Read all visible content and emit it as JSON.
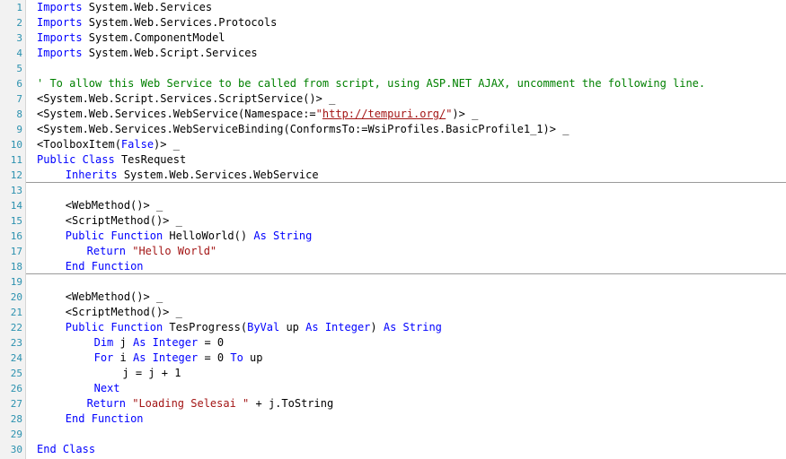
{
  "editor": {
    "lines": [
      {
        "n": "1",
        "indent": 0,
        "tokens": [
          {
            "t": "Imports",
            "k": "kw"
          },
          {
            "t": " System.Web.Services",
            "k": "tx"
          }
        ]
      },
      {
        "n": "2",
        "indent": 0,
        "tokens": [
          {
            "t": "Imports",
            "k": "kw"
          },
          {
            "t": " System.Web.Services.Protocols",
            "k": "tx"
          }
        ]
      },
      {
        "n": "3",
        "indent": 0,
        "tokens": [
          {
            "t": "Imports",
            "k": "kw"
          },
          {
            "t": " System.ComponentModel",
            "k": "tx"
          }
        ]
      },
      {
        "n": "4",
        "indent": 0,
        "tokens": [
          {
            "t": "Imports",
            "k": "kw"
          },
          {
            "t": " System.Web.Script.Services",
            "k": "tx"
          }
        ]
      },
      {
        "n": "5",
        "indent": 0,
        "tokens": []
      },
      {
        "n": "6",
        "indent": 0,
        "tokens": [
          {
            "t": "' To allow this Web Service to be called from script, using ASP.NET AJAX, uncomment the following line.",
            "k": "cm"
          }
        ]
      },
      {
        "n": "7",
        "indent": 0,
        "tokens": [
          {
            "t": "<System.Web.Script.Services.ScriptService()> _",
            "k": "tx"
          }
        ]
      },
      {
        "n": "8",
        "indent": 0,
        "tokens": [
          {
            "t": "<System.Web.Services.WebService(Namespace:=",
            "k": "tx"
          },
          {
            "t": "\"",
            "k": "st"
          },
          {
            "t": "http://tempuri.org/",
            "k": "url"
          },
          {
            "t": "\"",
            "k": "st"
          },
          {
            "t": ")> _",
            "k": "tx"
          }
        ]
      },
      {
        "n": "9",
        "indent": 0,
        "tokens": [
          {
            "t": "<System.Web.Services.WebServiceBinding(ConformsTo:=WsiProfiles.BasicProfile1_1)> _",
            "k": "tx"
          }
        ]
      },
      {
        "n": "10",
        "indent": 0,
        "tokens": [
          {
            "t": "<ToolboxItem(",
            "k": "tx"
          },
          {
            "t": "False",
            "k": "kw"
          },
          {
            "t": ")> _",
            "k": "tx"
          }
        ]
      },
      {
        "n": "11",
        "indent": 0,
        "tokens": [
          {
            "t": "Public",
            "k": "kw"
          },
          {
            "t": " ",
            "k": "tx"
          },
          {
            "t": "Class",
            "k": "kw"
          },
          {
            "t": " TesRequest",
            "k": "tx"
          }
        ]
      },
      {
        "n": "12",
        "indent": 4,
        "tokens": [
          {
            "t": "Inherits",
            "k": "kw"
          },
          {
            "t": " System.Web.Services.WebService",
            "k": "tx"
          }
        ]
      },
      {
        "n": "13",
        "indent": 0,
        "tokens": []
      },
      {
        "n": "14",
        "indent": 4,
        "tokens": [
          {
            "t": "<WebMethod()> _",
            "k": "tx"
          }
        ]
      },
      {
        "n": "15",
        "indent": 4,
        "tokens": [
          {
            "t": "<ScriptMethod()> _",
            "k": "tx"
          }
        ]
      },
      {
        "n": "16",
        "indent": 4,
        "tokens": [
          {
            "t": "Public",
            "k": "kw"
          },
          {
            "t": " ",
            "k": "tx"
          },
          {
            "t": "Function",
            "k": "kw"
          },
          {
            "t": " HelloWorld() ",
            "k": "tx"
          },
          {
            "t": "As",
            "k": "kw"
          },
          {
            "t": " ",
            "k": "tx"
          },
          {
            "t": "String",
            "k": "kw"
          }
        ]
      },
      {
        "n": "17",
        "indent": 7,
        "tokens": [
          {
            "t": "Return",
            "k": "kw"
          },
          {
            "t": " ",
            "k": "tx"
          },
          {
            "t": "\"Hello World\"",
            "k": "st"
          }
        ]
      },
      {
        "n": "18",
        "indent": 4,
        "tokens": [
          {
            "t": "End",
            "k": "kw"
          },
          {
            "t": " ",
            "k": "tx"
          },
          {
            "t": "Function",
            "k": "kw"
          }
        ]
      },
      {
        "n": "19",
        "indent": 0,
        "tokens": []
      },
      {
        "n": "20",
        "indent": 4,
        "tokens": [
          {
            "t": "<WebMethod()> _",
            "k": "tx"
          }
        ]
      },
      {
        "n": "21",
        "indent": 4,
        "tokens": [
          {
            "t": "<ScriptMethod()> _",
            "k": "tx"
          }
        ]
      },
      {
        "n": "22",
        "indent": 4,
        "tokens": [
          {
            "t": "Public",
            "k": "kw"
          },
          {
            "t": " ",
            "k": "tx"
          },
          {
            "t": "Function",
            "k": "kw"
          },
          {
            "t": " TesProgress(",
            "k": "tx"
          },
          {
            "t": "ByVal",
            "k": "kw"
          },
          {
            "t": " up ",
            "k": "tx"
          },
          {
            "t": "As",
            "k": "kw"
          },
          {
            "t": " ",
            "k": "tx"
          },
          {
            "t": "Integer",
            "k": "kw"
          },
          {
            "t": ") ",
            "k": "tx"
          },
          {
            "t": "As",
            "k": "kw"
          },
          {
            "t": " ",
            "k": "tx"
          },
          {
            "t": "String",
            "k": "kw"
          }
        ]
      },
      {
        "n": "23",
        "indent": 8,
        "tokens": [
          {
            "t": "Dim",
            "k": "kw"
          },
          {
            "t": " j ",
            "k": "tx"
          },
          {
            "t": "As",
            "k": "kw"
          },
          {
            "t": " ",
            "k": "tx"
          },
          {
            "t": "Integer",
            "k": "kw"
          },
          {
            "t": " = 0",
            "k": "tx"
          }
        ]
      },
      {
        "n": "24",
        "indent": 8,
        "tokens": [
          {
            "t": "For",
            "k": "kw"
          },
          {
            "t": " i ",
            "k": "tx"
          },
          {
            "t": "As",
            "k": "kw"
          },
          {
            "t": " ",
            "k": "tx"
          },
          {
            "t": "Integer",
            "k": "kw"
          },
          {
            "t": " = 0 ",
            "k": "tx"
          },
          {
            "t": "To",
            "k": "kw"
          },
          {
            "t": " up",
            "k": "tx"
          }
        ]
      },
      {
        "n": "25",
        "indent": 12,
        "tokens": [
          {
            "t": "j = j + 1",
            "k": "tx"
          }
        ]
      },
      {
        "n": "26",
        "indent": 8,
        "tokens": [
          {
            "t": "Next",
            "k": "kw"
          }
        ]
      },
      {
        "n": "27",
        "indent": 7,
        "tokens": [
          {
            "t": "Return",
            "k": "kw"
          },
          {
            "t": " ",
            "k": "tx"
          },
          {
            "t": "\"Loading Selesai \"",
            "k": "st"
          },
          {
            "t": " + j.ToString",
            "k": "tx"
          }
        ]
      },
      {
        "n": "28",
        "indent": 4,
        "tokens": [
          {
            "t": "End",
            "k": "kw"
          },
          {
            "t": " ",
            "k": "tx"
          },
          {
            "t": "Function",
            "k": "kw"
          }
        ]
      },
      {
        "n": "29",
        "indent": 0,
        "tokens": []
      },
      {
        "n": "30",
        "indent": 0,
        "tokens": [
          {
            "t": "End",
            "k": "kw"
          },
          {
            "t": " ",
            "k": "tx"
          },
          {
            "t": "Class",
            "k": "kw"
          }
        ]
      }
    ],
    "separator_after_lines": [
      "12",
      "18"
    ]
  },
  "colors": {
    "keyword": "#0000ff",
    "comment": "#008000",
    "string": "#a31515",
    "line_number": "#2b91af",
    "background": "#ffffff",
    "separator": "#9a9a9a"
  }
}
